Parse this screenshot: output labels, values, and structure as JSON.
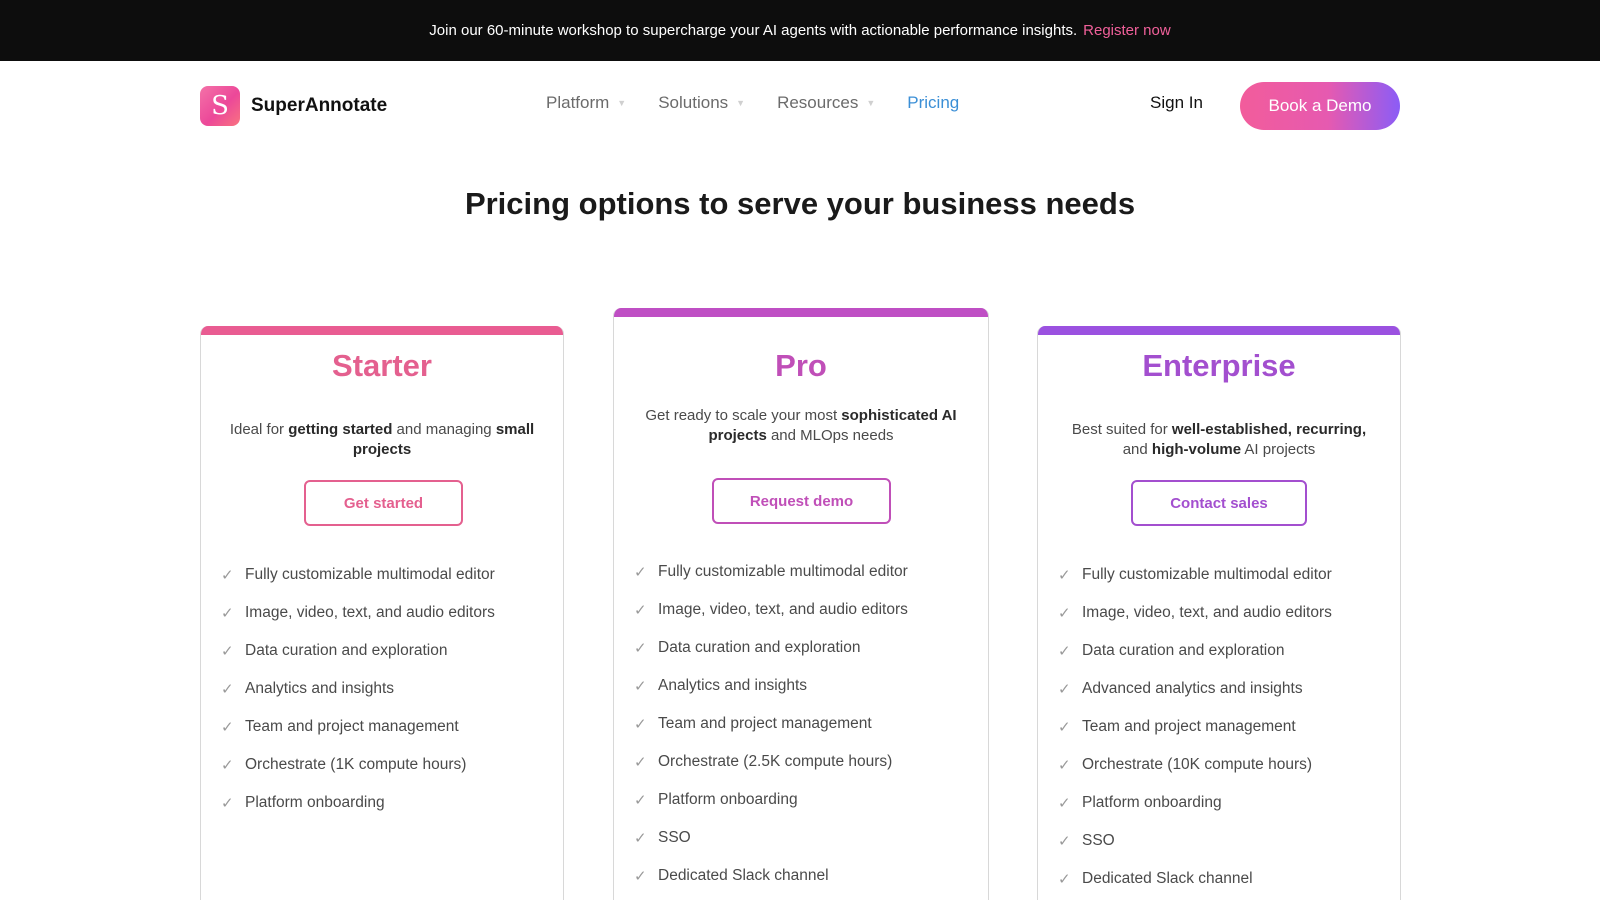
{
  "banner": {
    "text": "Join our 60-minute workshop to supercharge your AI agents with actionable performance insights.",
    "link": "Register now"
  },
  "nav": {
    "logo_letter": "S",
    "brand": "SuperAnnotate",
    "items": [
      {
        "label": "Platform"
      },
      {
        "label": "Solutions"
      },
      {
        "label": "Resources"
      },
      {
        "label": "Pricing"
      }
    ],
    "signin": "Sign In",
    "demo": "Book a Demo"
  },
  "headline": "Pricing options to serve your business needs",
  "plans": [
    {
      "title": "Starter",
      "desc": [
        {
          "text": "Ideal for ",
          "bold": false
        },
        {
          "text": "getting started",
          "bold": true
        },
        {
          "text": " and managing ",
          "bold": false
        },
        {
          "text": "small projects",
          "bold": true
        }
      ],
      "button": "Get started",
      "features": [
        "Fully customizable multimodal editor",
        "Image, video, text, and audio editors",
        "Data curation and exploration",
        "Analytics and insights",
        "Team and project management",
        "Orchestrate (1K compute hours)",
        "Platform onboarding"
      ]
    },
    {
      "title": "Pro",
      "desc": [
        {
          "text": "Get ready to scale your most ",
          "bold": false
        },
        {
          "text": "sophisticated AI projects",
          "bold": true
        },
        {
          "text": " and MLOps needs",
          "bold": false
        }
      ],
      "button": "Request demo",
      "features": [
        "Fully customizable multimodal editor",
        "Image, video, text, and audio editors",
        "Data curation and exploration",
        "Analytics and insights",
        "Team and project management",
        "Orchestrate (2.5K compute hours)",
        "Platform onboarding",
        "SSO",
        "Dedicated Slack channel"
      ]
    },
    {
      "title": "Enterprise",
      "desc": [
        {
          "text": "Best suited for ",
          "bold": false
        },
        {
          "text": "well-established, recurring,",
          "bold": true
        },
        {
          "text": " and ",
          "bold": false
        },
        {
          "text": "high-volume",
          "bold": true
        },
        {
          "text": " AI projects",
          "bold": false
        }
      ],
      "button": "Contact sales",
      "features": [
        "Fully customizable multimodal editor",
        "Image, video, text, and audio editors",
        "Data curation and exploration",
        "Advanced analytics and insights",
        "Team and project management",
        "Orchestrate (10K compute hours)",
        "Platform onboarding",
        "SSO",
        "Dedicated Slack channel"
      ]
    }
  ],
  "colors": {
    "starter": "#e4608f",
    "pro": "#c04fb8",
    "enterprise": "#a34fcf",
    "active_nav": "#3b8fd6",
    "banner_link": "#f0609a"
  }
}
